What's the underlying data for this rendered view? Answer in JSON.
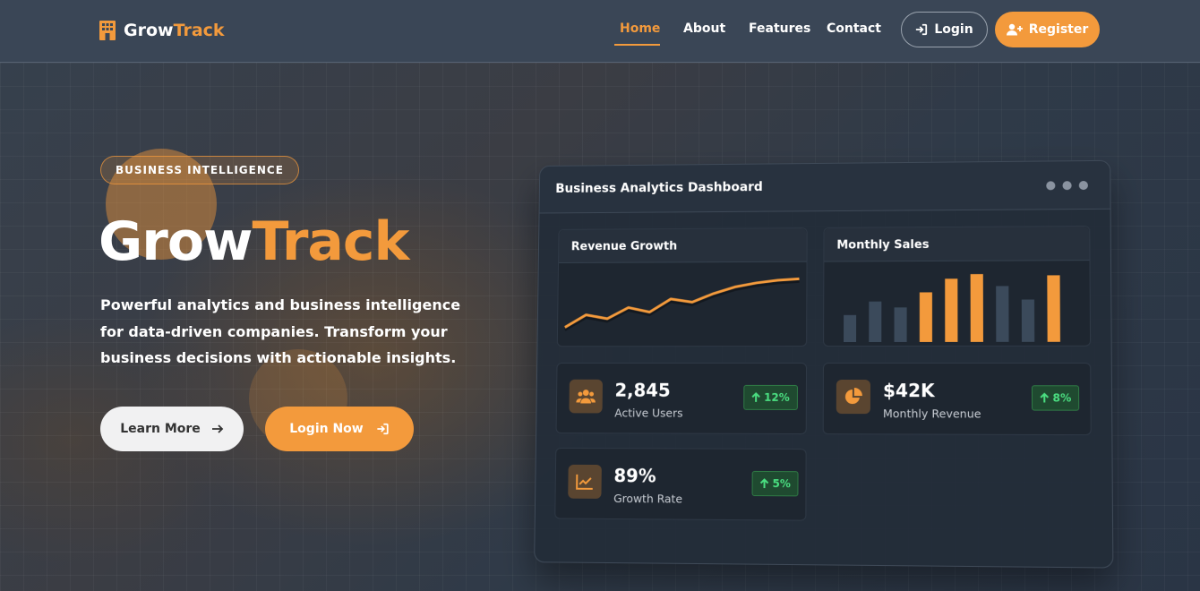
{
  "nav": {
    "brand_part1": "Grow",
    "brand_part2": "Track",
    "brand_icon": "building-icon",
    "links": [
      "Home",
      "About",
      "Features",
      "Contact"
    ],
    "active_link": "Home",
    "login_label": "Login",
    "register_label": "Register"
  },
  "hero": {
    "badge": "BUSINESS INTELLIGENCE",
    "title_part1": "Grow",
    "title_part2": "Track",
    "description": "Powerful analytics and business intelligence for data-driven companies. Transform your business decisions with actionable insights.",
    "learn_more_label": "Learn More",
    "login_now_label": "Login Now"
  },
  "dashboard": {
    "title": "Business Analytics Dashboard",
    "revenue_panel_title": "Revenue Growth",
    "sales_panel_title": "Monthly Sales",
    "stats": [
      {
        "value": "2,845",
        "label": "Active Users",
        "change": "12%",
        "icon": "users-icon"
      },
      {
        "value": "$42K",
        "label": "Monthly Revenue",
        "change": "8%",
        "icon": "pie-chart-icon"
      },
      {
        "value": "89%",
        "label": "Growth Rate",
        "change": "5%",
        "icon": "line-chart-icon"
      }
    ]
  },
  "chart_data": [
    {
      "type": "line",
      "title": "Revenue Growth",
      "x": [
        1,
        2,
        3,
        4,
        5,
        6,
        7,
        8,
        9,
        10,
        11,
        12
      ],
      "values": [
        15,
        34,
        28,
        45,
        38,
        58,
        53,
        66,
        76,
        82,
        86,
        88
      ],
      "ylim": [
        0,
        100
      ],
      "color": "#f39a3c"
    },
    {
      "type": "bar",
      "title": "Monthly Sales",
      "values": [
        36,
        54,
        46,
        66,
        84,
        90,
        74,
        56,
        88
      ],
      "highlight": [
        false,
        false,
        false,
        true,
        true,
        true,
        false,
        false,
        true
      ],
      "ylim": [
        0,
        100
      ],
      "colors": {
        "default": "#3b4a5b",
        "highlight": "#f39a3c"
      }
    }
  ],
  "colors": {
    "accent": "#f39a3c",
    "positive": "#4ade80",
    "nav_bg": "#3a4656"
  }
}
